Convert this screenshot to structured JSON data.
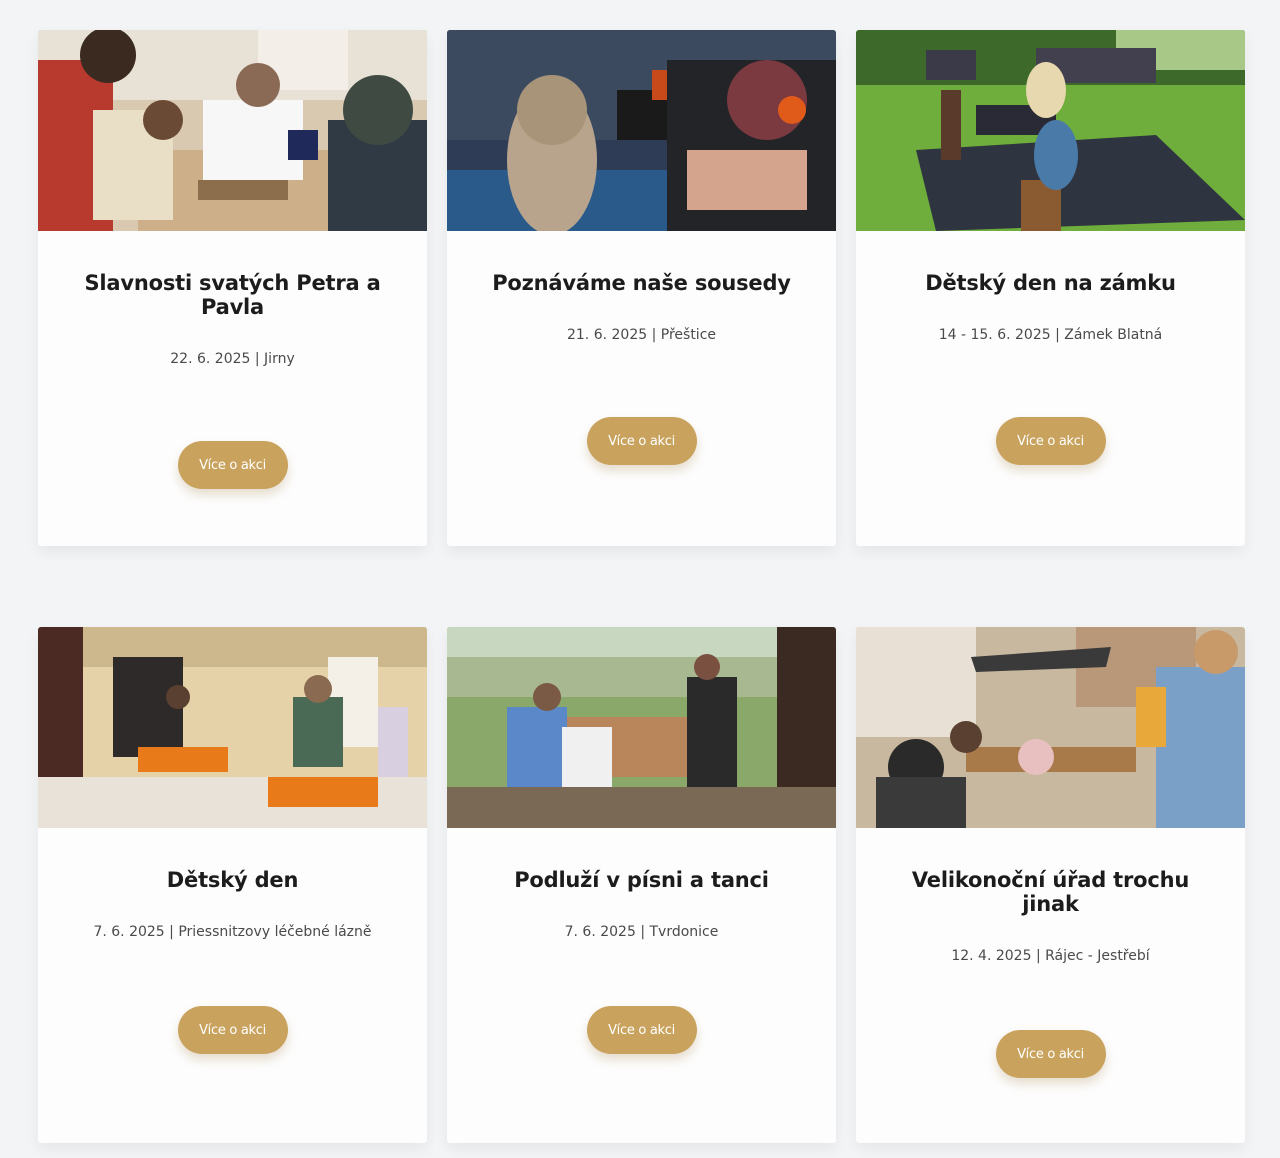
{
  "events": [
    {
      "title": "Slavnosti svatých Petra a Pavla",
      "date": "22. 6. 2025",
      "separator": "|",
      "place": "Jirny",
      "button": "Více o akci",
      "photo_icon": "photo-workshop-kids"
    },
    {
      "title": "Poznáváme naše sousedy",
      "date": "21. 6. 2025",
      "separator": "|",
      "place": "Přeštice",
      "button": "Více o akci",
      "photo_icon": "photo-chainsaw-carving"
    },
    {
      "title": "Dětský den na zámku",
      "date": "14 - 15. 6. 2025",
      "separator": "|",
      "place": "Zámek Blatná",
      "button": "Více o akci",
      "photo_icon": "photo-park-tents"
    },
    {
      "title": "Dětský den",
      "date": "7. 6. 2025",
      "separator": "|",
      "place": "Priessnitzovy léčebné lázně",
      "button": "Více o akci",
      "photo_icon": "photo-indoor-workbenches"
    },
    {
      "title": "Podluží v písni a tanci",
      "date": "7. 6. 2025",
      "separator": "|",
      "place": "Tvrdonice",
      "button": "Více o akci",
      "photo_icon": "photo-outdoor-tables"
    },
    {
      "title": "Velikonoční úřad trochu jinak",
      "date": "12. 4. 2025",
      "separator": "|",
      "place": "Rájec - Jestřebí",
      "button": "Více o akci",
      "photo_icon": "photo-courtyard-crowd"
    }
  ],
  "colors": {
    "page_background": "#f3f4f6",
    "card_background": "#fdfdfd",
    "button_background": "#c9a35e",
    "button_text": "#ffffff",
    "title_text": "#1c1c1c",
    "meta_text": "#4a4a4a"
  }
}
